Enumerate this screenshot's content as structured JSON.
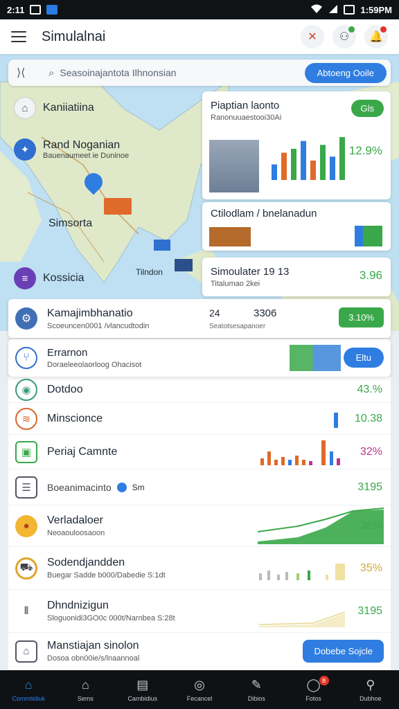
{
  "status_bar": {
    "time_left": "2:11",
    "time_right": "1:59PM"
  },
  "app": {
    "title": "Simulalnai"
  },
  "search": {
    "placeholder": "Seasoinajantota Ilhnonsian",
    "button": "Abtoeng Ooile"
  },
  "map_labels": [
    {
      "title": "Kaniiatiina",
      "sub": ""
    },
    {
      "title": "Rand Noganian",
      "sub": "Bauenaumeet ie Duninoe"
    },
    {
      "title": "Simsorta",
      "sub": ""
    },
    {
      "title": "Kossicia",
      "sub": ""
    },
    {
      "title": "Tilndon",
      "sub": ""
    }
  ],
  "cards": [
    {
      "title": "Piaptian laonto",
      "sub": "Ranonuuaestooi30Ai",
      "badge": "Gls",
      "value": "12.9%",
      "bars": [
        4,
        7,
        8,
        10,
        5,
        9,
        6,
        11
      ]
    },
    {
      "title": "Ctilodlam / bnelanadun",
      "value": ""
    },
    {
      "title": "Simoulater 19  13",
      "sub": "Titalumao 2kei",
      "value": "3.96"
    }
  ],
  "highlight_rows": [
    {
      "title": "Kamajimbhanatio",
      "sub": "Scoeuncen0001 /vlancudtodin",
      "mid_a": "24",
      "mid_b": "3306",
      "mid_sub": "Seatotsesapanoer",
      "badge": "3.10%"
    },
    {
      "title": "Errarnon",
      "sub": "Doraeleeolaorloog Ohacisot",
      "badge": "Eltu"
    }
  ],
  "list_rows": [
    {
      "name": "Dotdoo",
      "sub": "",
      "value": "43.%",
      "color": "#3aa84a"
    },
    {
      "name": "Minscionce",
      "sub": "",
      "value": "10.38",
      "color": "#3aa84a"
    },
    {
      "name": "Periaj Camnte",
      "sub": "",
      "value": "32%",
      "color": "#c0348f"
    },
    {
      "name": "Boeanimacinto",
      "sub": "",
      "value": "3195",
      "color": "#3aa84a"
    },
    {
      "name": "Verladaloer",
      "sub": "Neoaouloosaoon",
      "value": "36%",
      "color": "#3aa84a"
    },
    {
      "name": "Sodendjandden",
      "sub": "Buegar Sadde b000/Dabedie S:1dt",
      "value": "35%",
      "color": "#d7a63a"
    },
    {
      "name": "Dhndnizigun",
      "sub": "Sloguonidi3GO0c 000t/Narnbea S:28t",
      "value": "3195",
      "color": "#3aa84a"
    },
    {
      "name": "Manstiajan sinolon",
      "sub": "Dosoa obn00ie/s/lnaannoal",
      "value": "",
      "color": "#3aa84a",
      "button": "Dobebe Sojcle"
    }
  ],
  "row4_tag": "Sm",
  "bottom_nav": [
    {
      "label": "Commtidiuk",
      "icon": "home-icon",
      "active": true
    },
    {
      "label": "Sems",
      "icon": "house-outline-icon"
    },
    {
      "label": "Cambidius",
      "icon": "dashboard-icon"
    },
    {
      "label": "Fecancel",
      "icon": "compass-icon"
    },
    {
      "label": "Dibios",
      "icon": "tools-icon"
    },
    {
      "label": "Fotos",
      "icon": "photo-icon",
      "badge": "B"
    },
    {
      "label": "Dubhoe",
      "icon": "profile-icon"
    }
  ],
  "colors": {
    "accent": "#2f7de1",
    "green": "#3aa84a",
    "map_land": "#dfe9c9",
    "map_water": "#bfe0f2"
  }
}
